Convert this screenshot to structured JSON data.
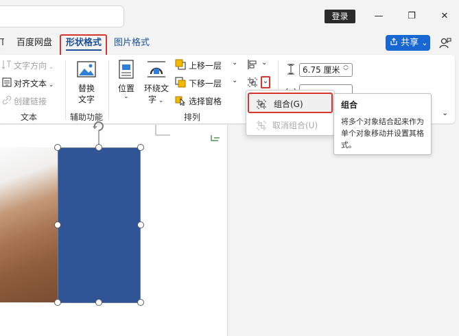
{
  "titlebar": {
    "login_label": "登录",
    "minimize_glyph": "—",
    "maximize_glyph": "❐",
    "close_glyph": "✕"
  },
  "tabs": [
    {
      "label": "百度网盘"
    },
    {
      "label": "形状格式"
    },
    {
      "label": "图片格式"
    }
  ],
  "share": {
    "label": "共享",
    "chevron": "⌄"
  },
  "ribbon": {
    "text_group": {
      "label": "文本",
      "text_direction": "文字方向",
      "align_text": "对齐文本",
      "create_link": "创建链接"
    },
    "assist_group": {
      "label": "辅助功能",
      "alt_text": [
        "替换",
        "文字"
      ]
    },
    "arrange_group": {
      "label": "排列",
      "position": "位置",
      "wrap_text": [
        "环绕文",
        "字"
      ],
      "bring_forward": "上移一层",
      "send_backward": "下移一层",
      "selection_pane": "选择窗格"
    },
    "size": {
      "height_value": "6.75 厘米"
    }
  },
  "menu": {
    "group_label": "组合(G)",
    "ungroup_label": "取消组合(U)"
  },
  "tooltip": {
    "title": "组合",
    "desc": "将多个对象结合起来作为单个对象移动并设置其格式。"
  },
  "colors": {
    "shape_fill": "#2f5597",
    "accent": "#1b4f9a",
    "highlight_border": "#d9342b",
    "share_button": "#1967d2"
  }
}
